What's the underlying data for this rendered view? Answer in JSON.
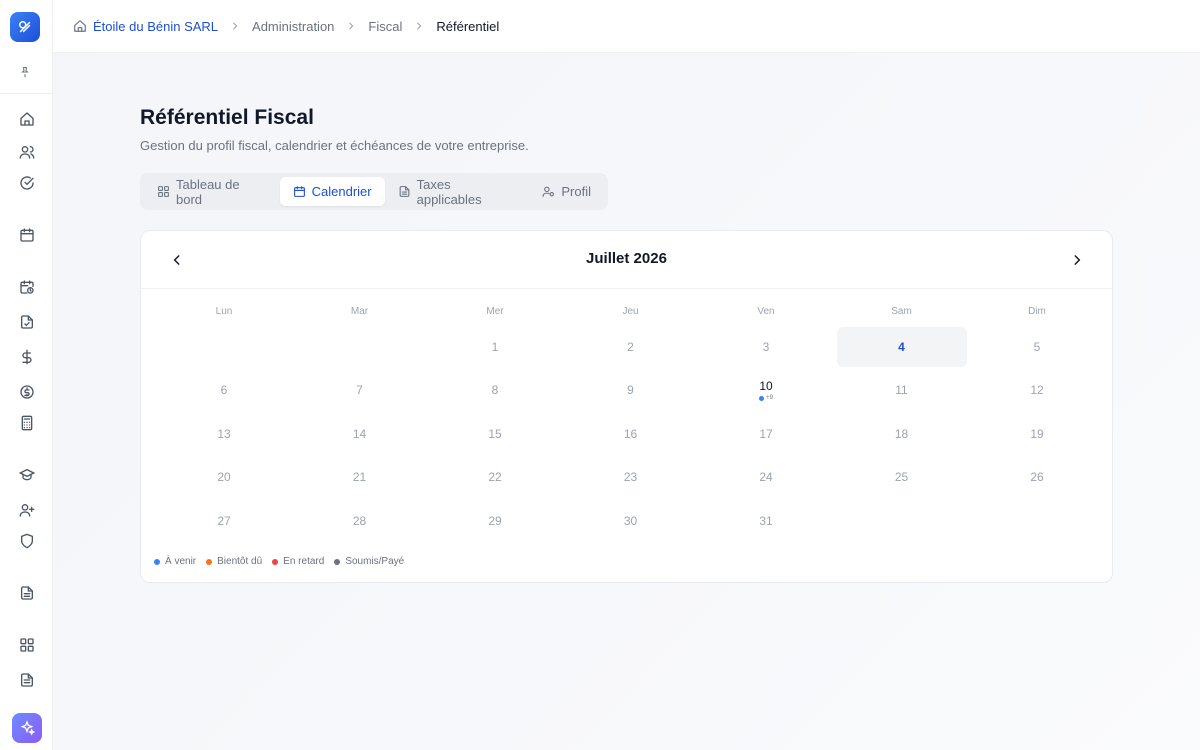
{
  "breadcrumb": {
    "company": "Étoile du Bénin SARL",
    "items": [
      "Administration",
      "Fiscal"
    ],
    "current": "Référentiel"
  },
  "page": {
    "title": "Référentiel Fiscal",
    "subtitle": "Gestion du profil fiscal, calendrier et échéances de votre entreprise."
  },
  "tabs": [
    {
      "label": "Tableau de bord",
      "icon": "grid-icon",
      "active": false
    },
    {
      "label": "Calendrier",
      "icon": "calendar-icon",
      "active": true
    },
    {
      "label": "Taxes applicables",
      "icon": "document-icon",
      "active": false
    },
    {
      "label": "Profil",
      "icon": "user-settings-icon",
      "active": false
    }
  ],
  "calendar": {
    "month_label": "Juillet 2026",
    "weekdays": [
      "Lun",
      "Mar",
      "Mer",
      "Jeu",
      "Ven",
      "Sam",
      "Dim"
    ],
    "weeks": [
      [
        "",
        "",
        "1",
        "2",
        "3",
        "4",
        "5"
      ],
      [
        "6",
        "7",
        "8",
        "9",
        "10",
        "11",
        "12"
      ],
      [
        "13",
        "14",
        "15",
        "16",
        "17",
        "18",
        "19"
      ],
      [
        "20",
        "21",
        "22",
        "23",
        "24",
        "25",
        "26"
      ],
      [
        "27",
        "28",
        "29",
        "30",
        "31",
        "",
        ""
      ]
    ],
    "today": "4",
    "event_day": "10",
    "event_more": "+9"
  },
  "legend": [
    {
      "label": "À venir",
      "color": "#3b82f6"
    },
    {
      "label": "Bientôt dû",
      "color": "#f97316"
    },
    {
      "label": "En retard",
      "color": "#ef4444"
    },
    {
      "label": "Soumis/Payé",
      "color": "#6b7280"
    }
  ],
  "sidebar_icons": [
    "home-icon",
    "users-icon",
    "check-circle-icon",
    "calendar-icon",
    "calendar-clock-icon",
    "file-check-icon",
    "dollar-icon",
    "coin-icon",
    "calculator-icon",
    "graduation-cap-icon",
    "user-plus-icon",
    "shield-icon",
    "file-text-icon",
    "dashboard-icon",
    "file-list-icon"
  ]
}
